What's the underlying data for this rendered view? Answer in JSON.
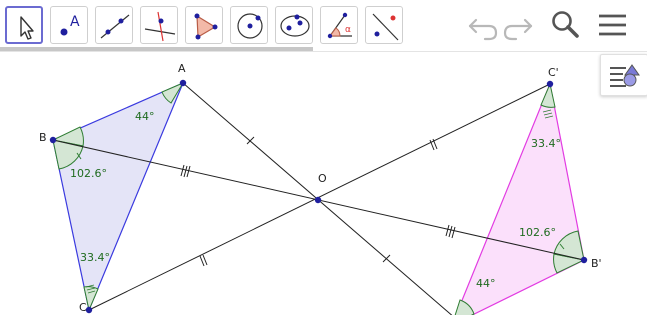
{
  "toolbar": {
    "tools": [
      {
        "name": "move-tool-icon",
        "active": true
      },
      {
        "name": "point-tool-icon",
        "glyph": "A"
      },
      {
        "name": "line-tool-icon"
      },
      {
        "name": "perpendicular-line-tool-icon"
      },
      {
        "name": "polygon-tool-icon"
      },
      {
        "name": "circle-tool-icon"
      },
      {
        "name": "conic-tool-icon"
      },
      {
        "name": "angle-tool-icon",
        "glyph": "α"
      },
      {
        "name": "reflect-tool-icon"
      }
    ],
    "undo_icon": "undo-icon",
    "redo_icon": "redo-icon",
    "search_icon": "search-icon",
    "menu_icon": "menu-icon"
  },
  "style_bar_icon": "style-bar-icon",
  "geometry": {
    "points": {
      "A": "A",
      "B": "B",
      "C": "C",
      "O": "O",
      "A_prime": "C'",
      "B_prime": "B'"
    },
    "angles": {
      "a_left": "44°",
      "b_left": "102.6°",
      "c_left": "33.4°",
      "c_right": "33.4°",
      "b_right": "102.6°",
      "a_right": "44°"
    }
  },
  "colors": {
    "triangle_left_fill": "#e4e4f7",
    "triangle_left_stroke": "#3a3adf",
    "triangle_right_fill": "#fbe0fb",
    "triangle_right_stroke": "#e23be2",
    "angle_stroke": "#2e7d32",
    "angle_fill": "#d4e6d4",
    "point": "#1f1f9e",
    "active_tool": "#6b6bd1"
  }
}
